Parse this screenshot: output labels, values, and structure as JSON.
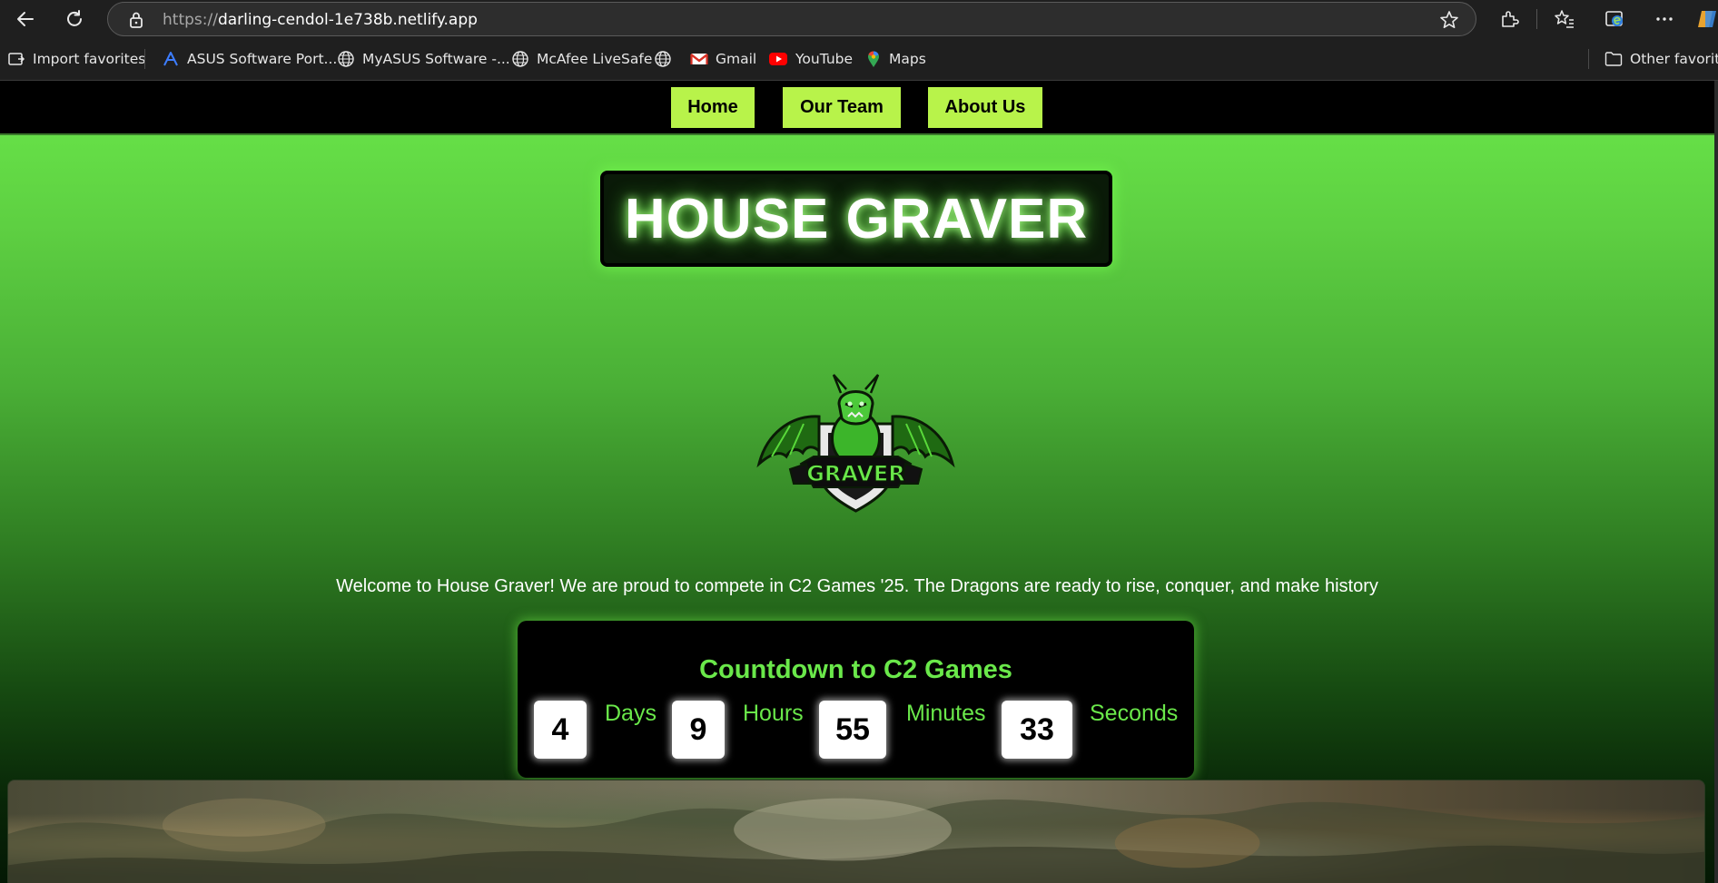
{
  "browser": {
    "url_protocol": "https://",
    "url_host": "darling-cendol-1e738b.netlify.app",
    "bookmarks": [
      {
        "label": "Import favorites",
        "icon": "import-favorites-icon"
      },
      {
        "label": "ASUS Software Port...",
        "icon": "asus-icon"
      },
      {
        "label": "MyASUS Software -...",
        "icon": "globe-icon"
      },
      {
        "label": "McAfee LiveSafe",
        "icon": "globe-icon"
      },
      {
        "label": "",
        "icon": "globe-icon"
      },
      {
        "label": "Gmail",
        "icon": "gmail-icon"
      },
      {
        "label": "YouTube",
        "icon": "youtube-icon"
      },
      {
        "label": "Maps",
        "icon": "maps-icon"
      }
    ],
    "other_favorites": "Other favorites"
  },
  "site": {
    "nav": [
      "Home",
      "Our Team",
      "About Us"
    ],
    "title": "HOUSE GRAVER",
    "logo_text": "GRAVER",
    "welcome": "Welcome to House Graver! We are proud to compete in C2 Games '25. The Dragons are ready to rise, conquer, and make history",
    "countdown": {
      "title": "Countdown to C2 Games",
      "days": "4",
      "days_label": "Days",
      "hours": "9",
      "hours_label": "Hours",
      "minutes": "55",
      "minutes_label": "Minutes",
      "seconds": "33",
      "seconds_label": "Seconds"
    }
  },
  "colors": {
    "accent_green": "#6ae84a",
    "nav_button": "#b8f34a",
    "nav_bar": "#000000"
  }
}
